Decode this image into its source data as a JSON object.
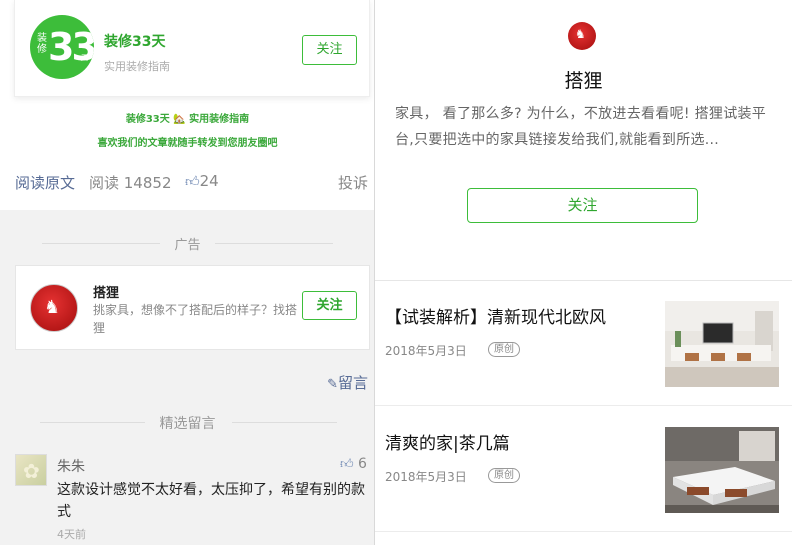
{
  "left_panel": {
    "account_card": {
      "logo_small_text": "装修",
      "logo_big_text": "33",
      "logo_tiny_text": "天",
      "name": "装修33天",
      "subtitle": "实用装修指南",
      "follow_label": "关注"
    },
    "slogan_line1": "装修33天 🏡 实用装修指南",
    "slogan_line2": "喜欢我们的文章就随手转发到您朋友圈吧",
    "stats": {
      "read_original": "阅读原文",
      "reads": "阅读 14852",
      "likes": "24",
      "report": "投诉"
    },
    "ad": {
      "section_label": "广告",
      "name": "搭狸",
      "description": "挑家具，想像不了搭配后的样子？找搭狸",
      "follow_label": "关注"
    },
    "comment_link": "留言",
    "selected_comments_label": "精选留言",
    "comment": {
      "author": "朱朱",
      "likes": "6",
      "text": "这款设计感觉不太好看，太压抑了，希望有别的款式",
      "time": "4天前"
    }
  },
  "right_panel": {
    "profile": {
      "name": "搭狸",
      "description": "家具， 看了那么多? 为什么，不放进去看看呢! 搭狸试装平台,只要把选中的家具链接发给我们,就能看到所选...",
      "follow_label": "关注"
    },
    "articles": [
      {
        "title": "【试装解析】清新现代北欧风",
        "date": "2018年5月3日",
        "badge": "原创"
      },
      {
        "title": "清爽的家|茶几篇",
        "date": "2018年5月3日",
        "badge": "原创"
      }
    ]
  },
  "colors": {
    "brand_green": "#3dbd3a",
    "link_blue": "#576b95",
    "brand_red": "#c41a1a"
  }
}
